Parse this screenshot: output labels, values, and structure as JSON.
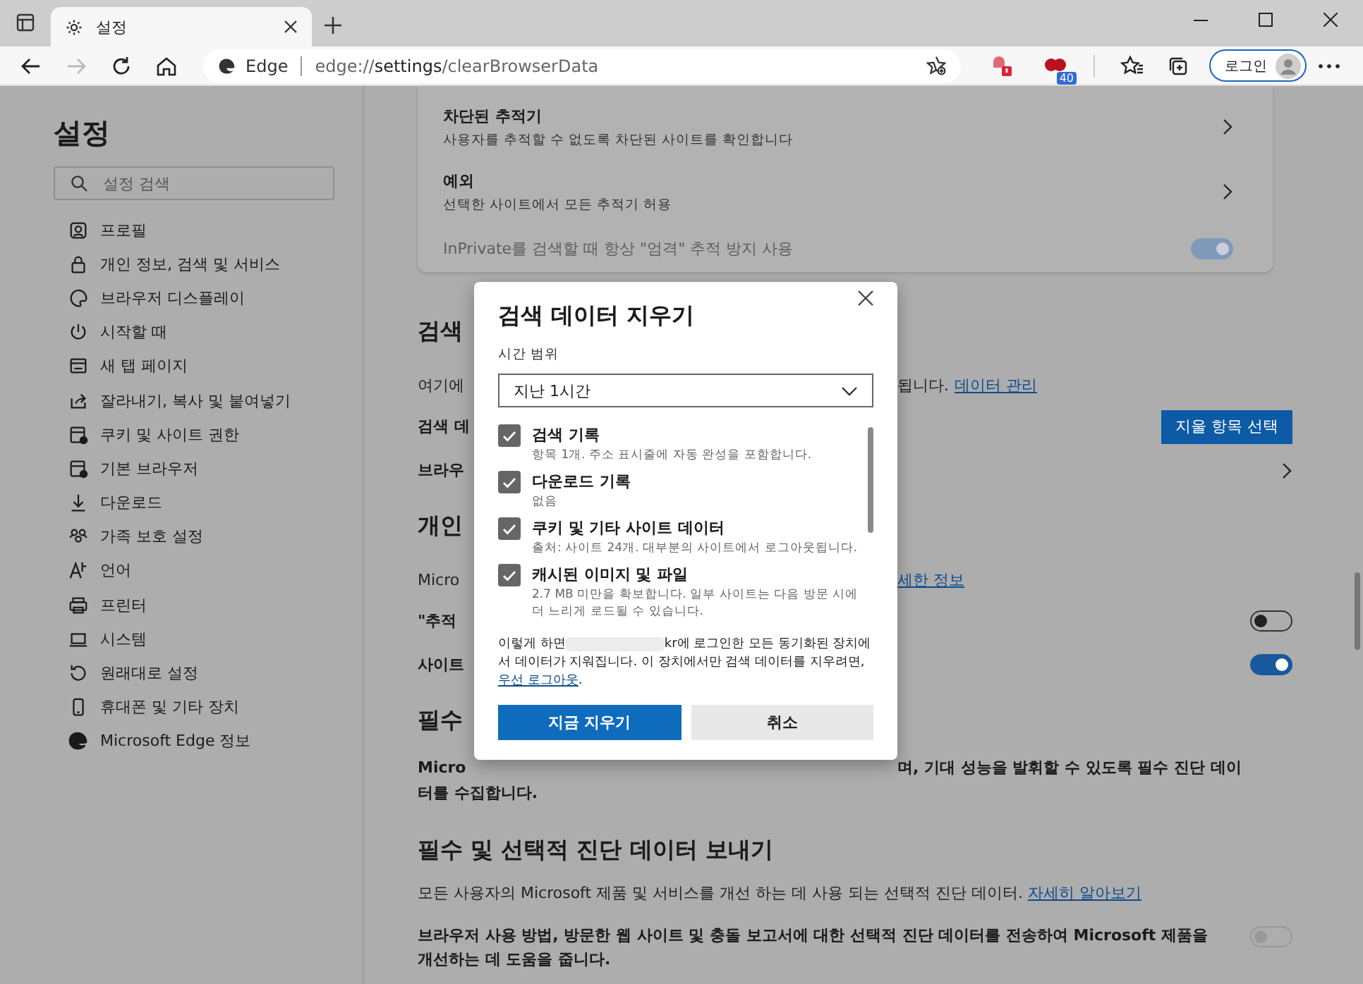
{
  "tabs": [
    {
      "label": "설정",
      "selected": true
    }
  ],
  "address_bar": {
    "site_label": "Edge",
    "url_prefix": "edge://",
    "url_host": "settings",
    "url_path": "/clearBrowserData"
  },
  "toolbar": {
    "extension_badge": "40",
    "login_label": "로그인"
  },
  "sidebar": {
    "title": "설정",
    "search": {
      "placeholder": "설정 검색"
    },
    "items": [
      {
        "label": "프로필"
      },
      {
        "label": "개인 정보, 검색 및 서비스"
      },
      {
        "label": "브라우저 디스플레이"
      },
      {
        "label": "시작할 때"
      },
      {
        "label": "새 탭 페이지"
      },
      {
        "label": "잘라내기, 복사 및 붙여넣기"
      },
      {
        "label": "쿠키 및 사이트 권한"
      },
      {
        "label": "기본 브라우저"
      },
      {
        "label": "다운로드"
      },
      {
        "label": "가족 보호 설정"
      },
      {
        "label": "언어"
      },
      {
        "label": "프린터"
      },
      {
        "label": "시스템"
      },
      {
        "label": "원래대로 설정"
      },
      {
        "label": "휴대폰 및 기타 장치"
      },
      {
        "label": "Microsoft Edge 정보"
      }
    ]
  },
  "tracking_card": {
    "rows": [
      {
        "kind": "nav",
        "title": "차단된 추적기",
        "description": "사용자를 추적할 수 없도록 차단된 사이트를 확인합니다"
      },
      {
        "kind": "nav",
        "title": "예외",
        "description": "선택한 사이트에서 모든 추적기 허용"
      },
      {
        "kind": "toggle",
        "title": "InPrivate를 검색할 때 항상 \"엄격\" 추적 방지 사용",
        "on": true,
        "disabled": true
      }
    ]
  },
  "background_rows": [
    {
      "kind": "heading",
      "left": "검색"
    },
    {
      "kind": "text",
      "left": "여기에",
      "right": "됩니다.",
      "link": "데이터 관리"
    },
    {
      "kind": "button",
      "left": "검색 데",
      "button": "지울 항목 선택"
    },
    {
      "kind": "nav",
      "left": "브라우"
    },
    {
      "kind": "heading",
      "left": "개인"
    },
    {
      "kind": "text",
      "left": "Micro",
      "link": "세한 정보"
    },
    {
      "kind": "toggle",
      "left": "\"추적",
      "on": false
    },
    {
      "kind": "toggle",
      "left": "사이트",
      "on": true
    },
    {
      "kind": "heading",
      "left": "필수"
    },
    {
      "kind": "bold",
      "left": "Micro",
      "right": "며, 기대 성능을 발휘할 수 있도록 필수 진단 데이"
    },
    {
      "kind": "bold",
      "left": "터를 수집합니다."
    }
  ],
  "diagnostics": {
    "heading": "필수 및 선택적 진단 데이터 보내기",
    "description": "모든 사용자의 Microsoft 제품 및 서비스를 개선 하는 데 사용 되는 선택적 진단 데이터.",
    "link": "자세히 알아보기",
    "setting": "브라우저 사용 방법, 방문한 웹 사이트 및 충돌 보고서에 대한 선택적 진단 데이터를 전송하여 Microsoft 제품을 개선하는 데 도움을 줍니다.",
    "on": false,
    "disabled": true
  },
  "dialog": {
    "title": "검색 데이터 지우기",
    "range_label": "시간 범위",
    "range_value": "지난 1시간",
    "options": [
      {
        "label": "검색 기록",
        "description": "항목 1개. 주소 표시줄에 자동 완성을 포함합니다.",
        "checked": true
      },
      {
        "label": "다운로드 기록",
        "description": "없음",
        "checked": true
      },
      {
        "label": "쿠키 및 기타 사이트 데이터",
        "description": "출처: 사이트 24개. 대부분의 사이트에서 로그아웃됩니다.",
        "checked": true
      },
      {
        "label": "캐시된 이미지 및 파일",
        "description": "2.7 MB 미만을 확보합니다. 일부 사이트는 다음 방문 시에 더 느리게 로드될 수 있습니다.",
        "checked": true
      }
    ],
    "note_before": "이렇게 하면",
    "note_after": "kr에 로그인한 모든 동기화된 장치에서 데이터가 지워집니다. 이 장치에서만 검색 데이터를 지우려면,",
    "note_link": "우선 로그아웃",
    "note_end": ".",
    "primary_button": "지금 지우기",
    "secondary_button": "취소"
  }
}
